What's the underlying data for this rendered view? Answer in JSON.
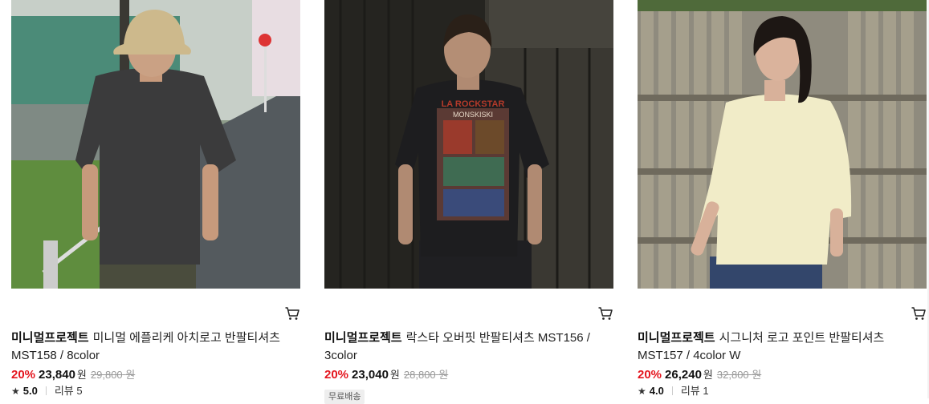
{
  "products": [
    {
      "brand": "미니멀프로젝트",
      "name": "미니멀 에플리케 아치로고 반팔티셔츠 MST158 / 8color",
      "discount": "20%",
      "price": "23,840",
      "currency": "원",
      "original_price": "29,800",
      "original_currency": "원",
      "star": "★",
      "rating": "5.0",
      "reviews": "리뷰 5"
    },
    {
      "brand": "미니멀프로젝트",
      "name": "락스타 오버핏 반팔티셔츠 MST156 / 3color",
      "discount": "20%",
      "price": "23,040",
      "currency": "원",
      "original_price": "28,800",
      "original_currency": "원",
      "tag": "무료배송"
    },
    {
      "brand": "미니멀프로젝트",
      "name": "시그니처 로고 포인트 반팔티셔츠 MST157 / 4color W",
      "discount": "20%",
      "price": "26,240",
      "currency": "원",
      "original_price": "32,800",
      "original_currency": "원",
      "star": "★",
      "rating": "4.0",
      "reviews": "리뷰 1"
    }
  ],
  "colors": {
    "discount": "#e4151e",
    "strikethrough": "#999999"
  },
  "icons": {
    "cart": "cart-icon",
    "star": "star-icon"
  },
  "graphic_text": {
    "shirt2_print": "MONSKISKI",
    "shirt2_logo": "LA ROCKSTAR"
  }
}
